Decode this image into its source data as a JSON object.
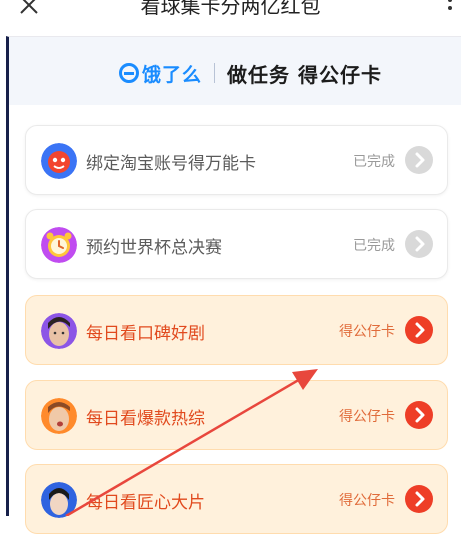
{
  "topbar": {
    "title": "看球集卡分两亿红包"
  },
  "header": {
    "brand": "饿了么",
    "title": "做任务 得公仔卡"
  },
  "tasks": [
    {
      "label": "绑定淘宝账号得万能卡",
      "status": "已完成",
      "state": "done",
      "icon": "taobao-icon"
    },
    {
      "label": "预约世界杯总决赛",
      "status": "已完成",
      "state": "done",
      "icon": "alarm-clock-icon"
    },
    {
      "label": "每日看口碑好剧",
      "status": "得公仔卡",
      "state": "active",
      "icon": "avatar-photo"
    },
    {
      "label": "每日看爆款热综",
      "status": "得公仔卡",
      "state": "active",
      "icon": "avatar-photo"
    },
    {
      "label": "每日看匠心大片",
      "status": "得公仔卡",
      "state": "active",
      "icon": "avatar-photo"
    }
  ],
  "colors": {
    "accent_red": "#ee3e27",
    "brand_blue": "#1a8cff",
    "active_bg": "#fff1dc",
    "annotation_arrow": "#e8473d"
  }
}
